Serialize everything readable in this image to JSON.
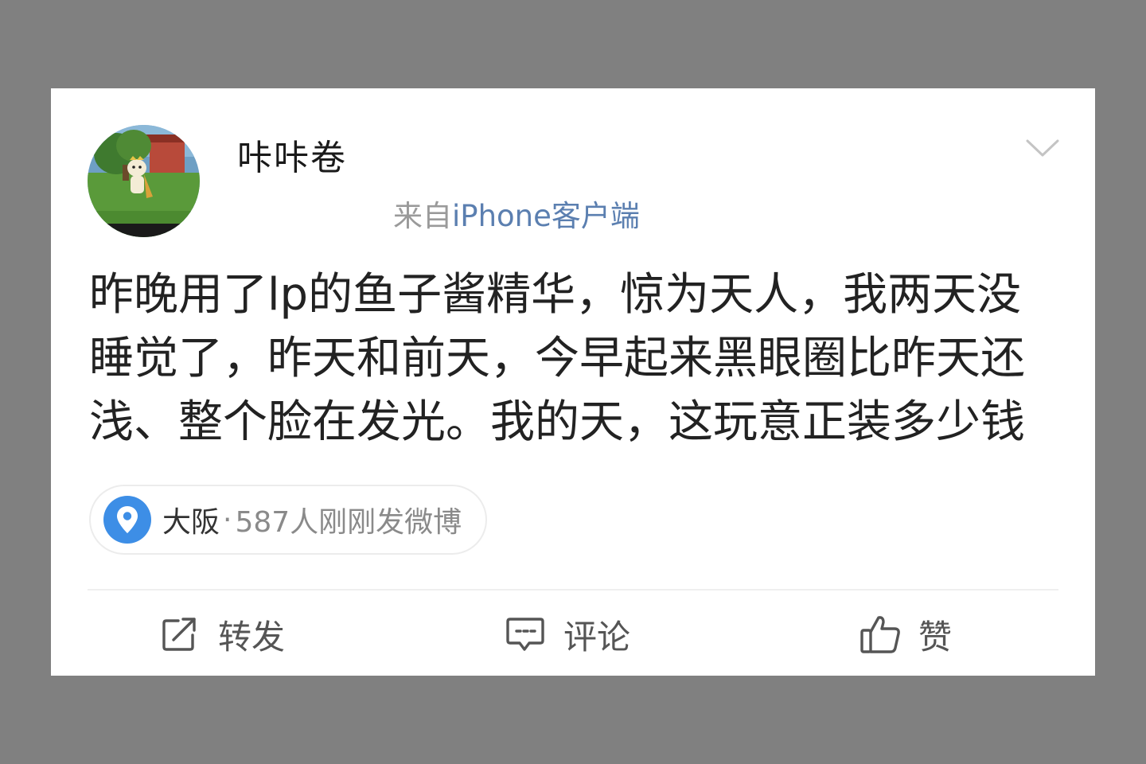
{
  "post": {
    "author": {
      "name": "咔咔卷"
    },
    "source": {
      "prefix": "来自",
      "client": "iPhone客户端"
    },
    "body_lines": [
      "昨晚用了lp的鱼子酱精华，惊为天人，我两天没",
      "睡觉了，昨天和前天，今早起来黑眼圈比昨天还",
      "浅、整个脸在发光。我的天，这玩意正装多少钱"
    ],
    "location": {
      "city": "大阪",
      "separator": "·",
      "meta": "587人刚刚发微博"
    }
  },
  "actions": {
    "repost": "转发",
    "comment": "评论",
    "like": "赞"
  },
  "colors": {
    "location_icon": "#3d8ee6",
    "client_link": "#5b7fb0",
    "frame": "#808080"
  },
  "icons": [
    "chevron-down-icon",
    "location-pin-icon",
    "repost-icon",
    "comment-icon",
    "thumbs-up-icon"
  ]
}
